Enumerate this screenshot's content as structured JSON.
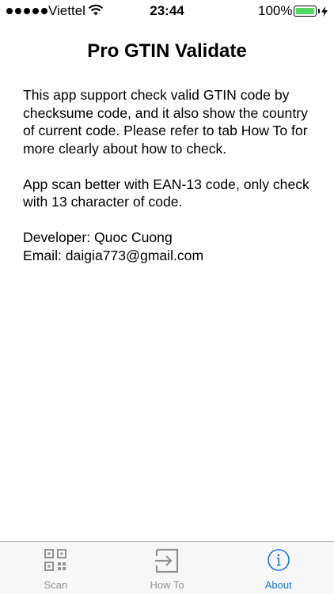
{
  "status_bar": {
    "carrier": "Viettel",
    "time": "23:44",
    "battery_percent": "100%",
    "battery_level": 1.0,
    "signal_bars": 5
  },
  "title": "Pro GTIN Validate",
  "body": {
    "paragraph1": "This app support check valid GTIN code by checksume code, and it also show the country of current code. Please refer to tab How To for more clearly about how to check.",
    "paragraph2": "App scan better with EAN-13 code, only check with 13 character of code.",
    "developer": "Developer: Quoc Cuong",
    "email": "Email: daigia773@gmail.com"
  },
  "tabs": [
    {
      "label": "Scan",
      "icon": "qr-code-icon",
      "active": false
    },
    {
      "label": "How To",
      "icon": "exit-arrow-icon",
      "active": false
    },
    {
      "label": "About",
      "icon": "info-icon",
      "active": true
    }
  ],
  "colors": {
    "accent": "#1a74e8",
    "inactive": "#929292",
    "battery": "#4cd964"
  }
}
